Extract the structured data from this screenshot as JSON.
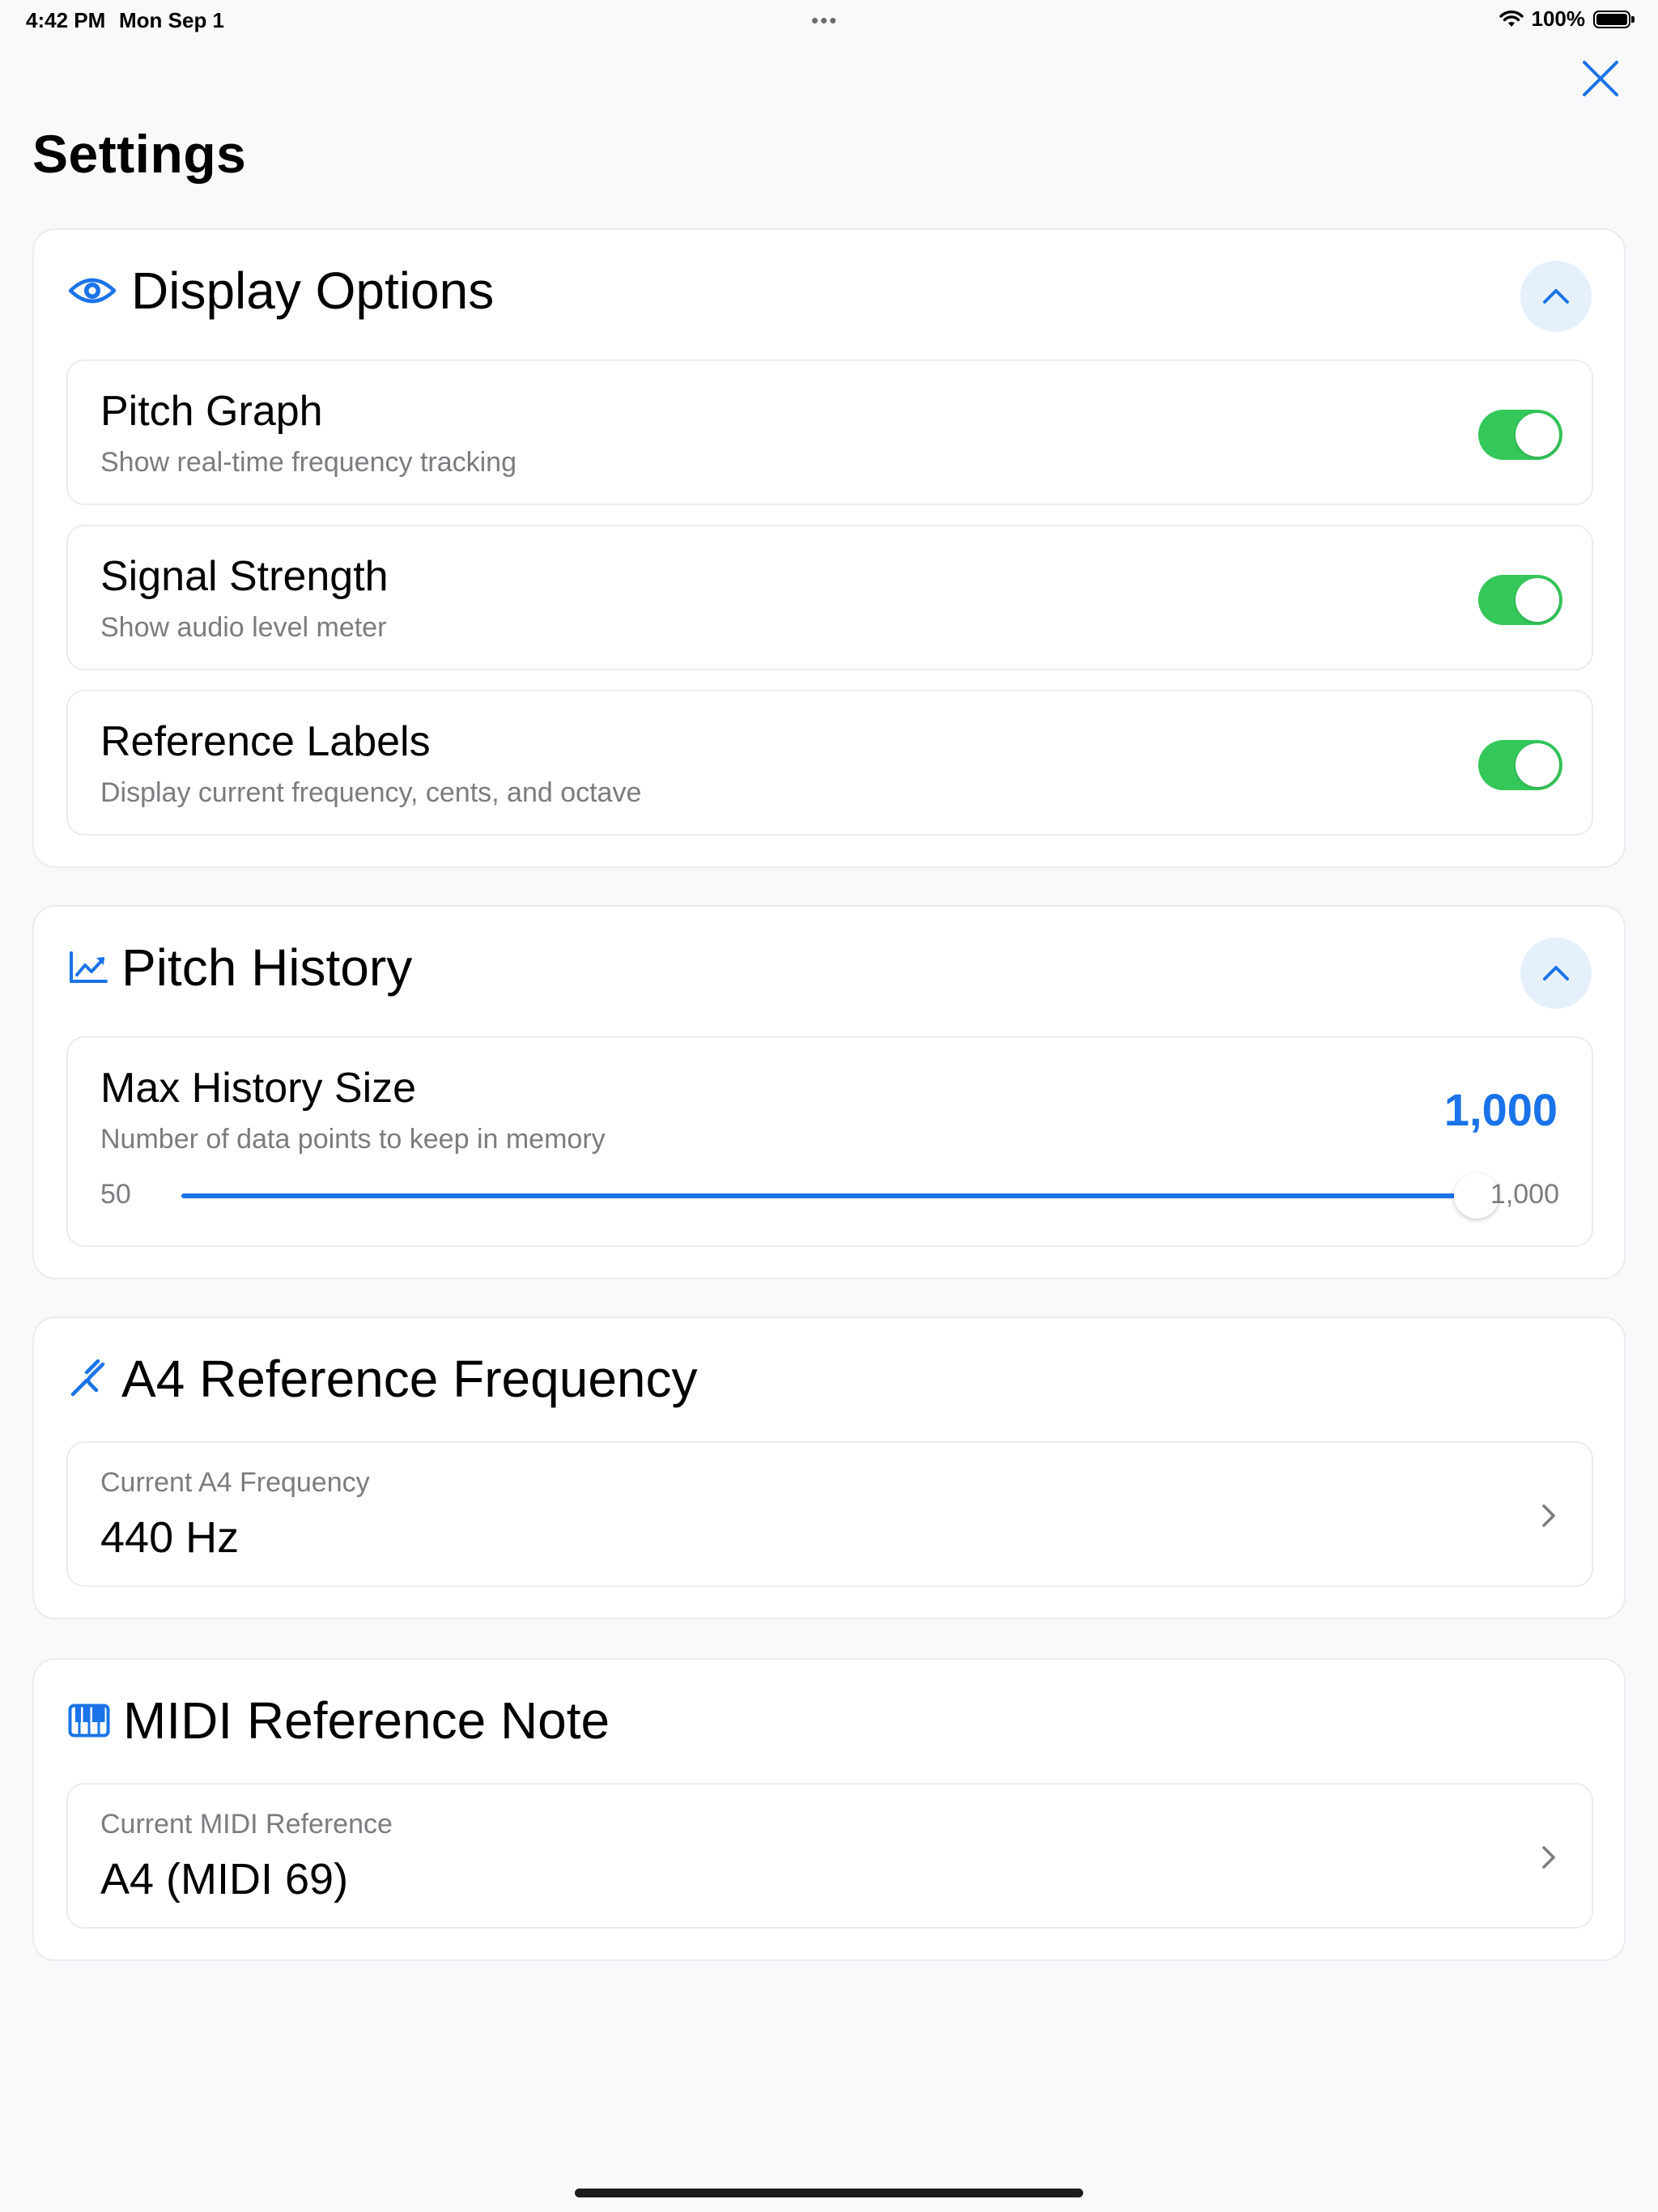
{
  "status_bar": {
    "time": "4:42 PM",
    "date": "Mon Sep 1",
    "dots": "•••",
    "battery": "100%"
  },
  "page": {
    "title": "Settings",
    "close_icon": "close-icon"
  },
  "colors": {
    "accent": "#1a73e8",
    "toggle_on": "#34c759",
    "collapse_bg": "#e6f0fd",
    "subtext": "#7b7b80"
  },
  "display_options": {
    "title": "Display Options",
    "icon": "eye-icon",
    "rows": [
      {
        "title": "Pitch Graph",
        "subtitle": "Show real-time frequency tracking",
        "enabled": true
      },
      {
        "title": "Signal Strength",
        "subtitle": "Show audio level meter",
        "enabled": true
      },
      {
        "title": "Reference Labels",
        "subtitle": "Display current frequency, cents, and octave",
        "enabled": true
      }
    ]
  },
  "pitch_history": {
    "title": "Pitch History",
    "icon": "chart-line-icon",
    "max_history": {
      "title": "Max History Size",
      "subtitle": "Number of data points to keep in memory",
      "value": "1,000",
      "min_label": "50",
      "max_label": "1,000",
      "slider_fraction": 1.0
    }
  },
  "a4_reference": {
    "title": "A4 Reference Frequency",
    "icon": "tuning-fork-icon",
    "label": "Current A4 Frequency",
    "value": "440 Hz"
  },
  "midi_reference": {
    "title": "MIDI Reference Note",
    "icon": "piano-keys-icon",
    "label": "Current MIDI Reference",
    "value": "A4 (MIDI 69)"
  }
}
